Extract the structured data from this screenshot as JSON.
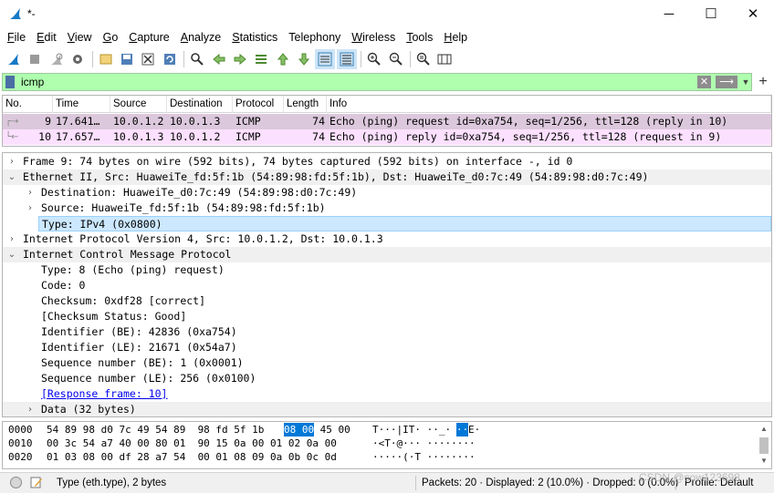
{
  "window": {
    "title": "*-",
    "minimize_glyph": "─",
    "maximize_glyph": "☐",
    "close_glyph": "✕"
  },
  "menu": [
    {
      "label": "File",
      "accel": "F",
      "rest": "ile"
    },
    {
      "label": "Edit",
      "accel": "E",
      "rest": "dit"
    },
    {
      "label": "View",
      "accel": "V",
      "rest": "iew"
    },
    {
      "label": "Go",
      "accel": "G",
      "rest": "o"
    },
    {
      "label": "Capture",
      "accel": "C",
      "rest": "apture"
    },
    {
      "label": "Analyze",
      "accel": "A",
      "rest": "nalyze"
    },
    {
      "label": "Statistics",
      "accel": "S",
      "rest": "tatistics"
    },
    {
      "label": "Telephony",
      "accel": "",
      "rest": "Telephony"
    },
    {
      "label": "Wireless",
      "accel": "W",
      "rest": "ireless"
    },
    {
      "label": "Tools",
      "accel": "T",
      "rest": "ools"
    },
    {
      "label": "Help",
      "accel": "H",
      "rest": "elp"
    }
  ],
  "toolbar": {
    "icons": [
      "shark-fin-start-icon",
      "stop-square-icon",
      "restart-fin-icon",
      "capture-options-gear-icon",
      "open-file-icon",
      "save-file-icon",
      "close-file-icon",
      "reload-file-icon",
      "find-packet-icon",
      "go-back-icon",
      "go-forward-icon",
      "go-to-packet-icon",
      "go-first-icon",
      "go-last-icon",
      "autoscroll-icon",
      "colorize-icon",
      "zoom-in-icon",
      "zoom-out-icon",
      "normal-size-icon",
      "resize-columns-icon"
    ]
  },
  "filter": {
    "value": "icmp",
    "clear_glyph": "✕",
    "apply_glyph": "⟶",
    "dropdown_glyph": "▼",
    "add_glyph": "+",
    "bg_color": "#afffaf"
  },
  "packet_list": {
    "columns": [
      "No.",
      "Time",
      "Source",
      "Destination",
      "Protocol",
      "Length",
      "Info"
    ],
    "rows": [
      {
        "no": "9",
        "time": "17.641…",
        "source": "10.0.1.2",
        "destination": "10.0.1.3",
        "protocol": "ICMP",
        "length": "74",
        "info": "Echo (ping) request  id=0xa754, seq=1/256, ttl=128 (reply in 10)",
        "bg": "#dcc8dc"
      },
      {
        "no": "10",
        "time": "17.657…",
        "source": "10.0.1.3",
        "destination": "10.0.1.2",
        "protocol": "ICMP",
        "length": "74",
        "info": "Echo (ping) reply    id=0xa754, seq=1/256, ttl=128 (request in 9)",
        "bg": "#fce0ff"
      }
    ]
  },
  "details": [
    {
      "indent": 0,
      "arrow": "›",
      "text": "Frame 9: 74 bytes on wire (592 bits), 74 bytes captured (592 bits) on interface -, id 0",
      "bg": "#ffffff",
      "link": false
    },
    {
      "indent": 0,
      "arrow": "⌄",
      "text": "Ethernet II, Src: HuaweiTe_fd:5f:1b (54:89:98:fd:5f:1b), Dst: HuaweiTe_d0:7c:49 (54:89:98:d0:7c:49)",
      "bg": "#f0f0f0",
      "link": false
    },
    {
      "indent": 1,
      "arrow": "›",
      "text": "Destination: HuaweiTe_d0:7c:49 (54:89:98:d0:7c:49)",
      "bg": "#ffffff",
      "link": false
    },
    {
      "indent": 1,
      "arrow": "›",
      "text": "Source: HuaweiTe_fd:5f:1b (54:89:98:fd:5f:1b)",
      "bg": "#ffffff",
      "link": false
    },
    {
      "indent": 1,
      "arrow": "",
      "text": "Type: IPv4 (0x0800)",
      "bg": "#cce8ff",
      "link": false
    },
    {
      "indent": 0,
      "arrow": "›",
      "text": "Internet Protocol Version 4, Src: 10.0.1.2, Dst: 10.0.1.3",
      "bg": "#ffffff",
      "link": false
    },
    {
      "indent": 0,
      "arrow": "⌄",
      "text": "Internet Control Message Protocol",
      "bg": "#f0f0f0",
      "link": false
    },
    {
      "indent": 1,
      "arrow": "",
      "text": "Type: 8 (Echo (ping) request)",
      "bg": "#ffffff",
      "link": false
    },
    {
      "indent": 1,
      "arrow": "",
      "text": "Code: 0",
      "bg": "#ffffff",
      "link": false
    },
    {
      "indent": 1,
      "arrow": "",
      "text": "Checksum: 0xdf28 [correct]",
      "bg": "#ffffff",
      "link": false
    },
    {
      "indent": 1,
      "arrow": "",
      "text": "[Checksum Status: Good]",
      "bg": "#ffffff",
      "link": false
    },
    {
      "indent": 1,
      "arrow": "",
      "text": "Identifier (BE): 42836 (0xa754)",
      "bg": "#ffffff",
      "link": false
    },
    {
      "indent": 1,
      "arrow": "",
      "text": "Identifier (LE): 21671 (0x54a7)",
      "bg": "#ffffff",
      "link": false
    },
    {
      "indent": 1,
      "arrow": "",
      "text": "Sequence number (BE): 1 (0x0001)",
      "bg": "#ffffff",
      "link": false
    },
    {
      "indent": 1,
      "arrow": "",
      "text": "Sequence number (LE): 256 (0x0100)",
      "bg": "#ffffff",
      "link": false
    },
    {
      "indent": 1,
      "arrow": "",
      "text": "[Response frame: 10]",
      "bg": "#ffffff",
      "link": true
    },
    {
      "indent": 1,
      "arrow": "›",
      "text": "Data (32 bytes)",
      "bg": "#f0f0f0",
      "link": false
    }
  ],
  "bytes": [
    {
      "offset": "0000",
      "hex_a": "54 89 98 d0 7c 49 54 89  98 fd 5f 1b ",
      "hex_hl": "08 00",
      "hex_b": " 45 00",
      "ascii_a": "T···|IT· ··_·",
      "ascii_hl": "··",
      "ascii_b": "E·"
    },
    {
      "offset": "0010",
      "hex_a": "00 3c 54 a7 40 00 80 01  90 15 0a 00 01 02 0a 00",
      "hex_hl": "",
      "hex_b": "",
      "ascii_a": "·<T·@··· ········",
      "ascii_hl": "",
      "ascii_b": ""
    },
    {
      "offset": "0020",
      "hex_a": "01 03 08 00 df 28 a7 54  00 01 08 09 0a 0b 0c 0d",
      "hex_hl": "",
      "hex_b": "",
      "ascii_a": "·····(·T ········",
      "ascii_hl": "",
      "ascii_b": ""
    }
  ],
  "status": {
    "field_info": "Type (eth.type), 2 bytes",
    "counts": "Packets: 20 · Displayed: 2 (10.0%) · Dropped: 0 (0.0%)",
    "profile": "Profile: Default",
    "watermark": "CSDN @cow123698"
  },
  "colors": {
    "highlight_bytes": "#0078d7",
    "selected_detail": "#cce8ff",
    "link": "#0000ee"
  }
}
